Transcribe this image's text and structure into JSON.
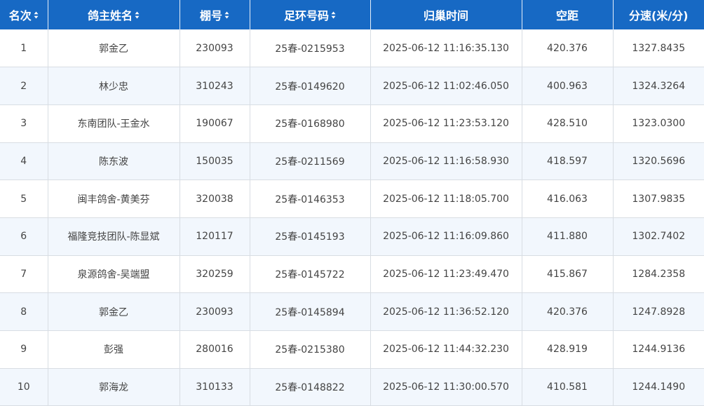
{
  "table": {
    "columns": [
      {
        "label": "名次",
        "sortable": true
      },
      {
        "label": "鸽主姓名",
        "sortable": true
      },
      {
        "label": "棚号",
        "sortable": true
      },
      {
        "label": "足环号码",
        "sortable": true
      },
      {
        "label": "归巢时间",
        "sortable": false
      },
      {
        "label": "空距",
        "sortable": false
      },
      {
        "label": "分速(米/分)",
        "sortable": false
      }
    ],
    "rows": [
      [
        "1",
        "郭金乙",
        "230093",
        "25春-0215953",
        "2025-06-12 11:16:35.130",
        "420.376",
        "1327.8435"
      ],
      [
        "2",
        "林少忠",
        "310243",
        "25春-0149620",
        "2025-06-12 11:02:46.050",
        "400.963",
        "1324.3264"
      ],
      [
        "3",
        "东南团队-王金水",
        "190067",
        "25春-0168980",
        "2025-06-12 11:23:53.120",
        "428.510",
        "1323.0300"
      ],
      [
        "4",
        "陈东波",
        "150035",
        "25春-0211569",
        "2025-06-12 11:16:58.930",
        "418.597",
        "1320.5696"
      ],
      [
        "5",
        "闽丰鸽舍-黄美芬",
        "320038",
        "25春-0146353",
        "2025-06-12 11:18:05.700",
        "416.063",
        "1307.9835"
      ],
      [
        "6",
        "福隆竞技团队-陈显斌",
        "120117",
        "25春-0145193",
        "2025-06-12 11:16:09.860",
        "411.880",
        "1302.7402"
      ],
      [
        "7",
        "泉源鸽舍-吴端盟",
        "320259",
        "25春-0145722",
        "2025-06-12 11:23:49.470",
        "415.867",
        "1284.2358"
      ],
      [
        "8",
        "郭金乙",
        "230093",
        "25春-0145894",
        "2025-06-12 11:36:52.120",
        "420.376",
        "1247.8928"
      ],
      [
        "9",
        "彭强",
        "280016",
        "25春-0215380",
        "2025-06-12 11:44:32.230",
        "428.919",
        "1244.9136"
      ],
      [
        "10",
        "郭海龙",
        "310133",
        "25春-0148822",
        "2025-06-12 11:30:00.570",
        "410.581",
        "1244.1490"
      ]
    ]
  },
  "colors": {
    "header_bg": "#1769c4",
    "header_text": "#ffffff",
    "row_alt_bg": "#f2f7fd",
    "border": "#d8dde3",
    "cell_text": "#444444"
  },
  "icons": {
    "sort": "sort-icon"
  }
}
